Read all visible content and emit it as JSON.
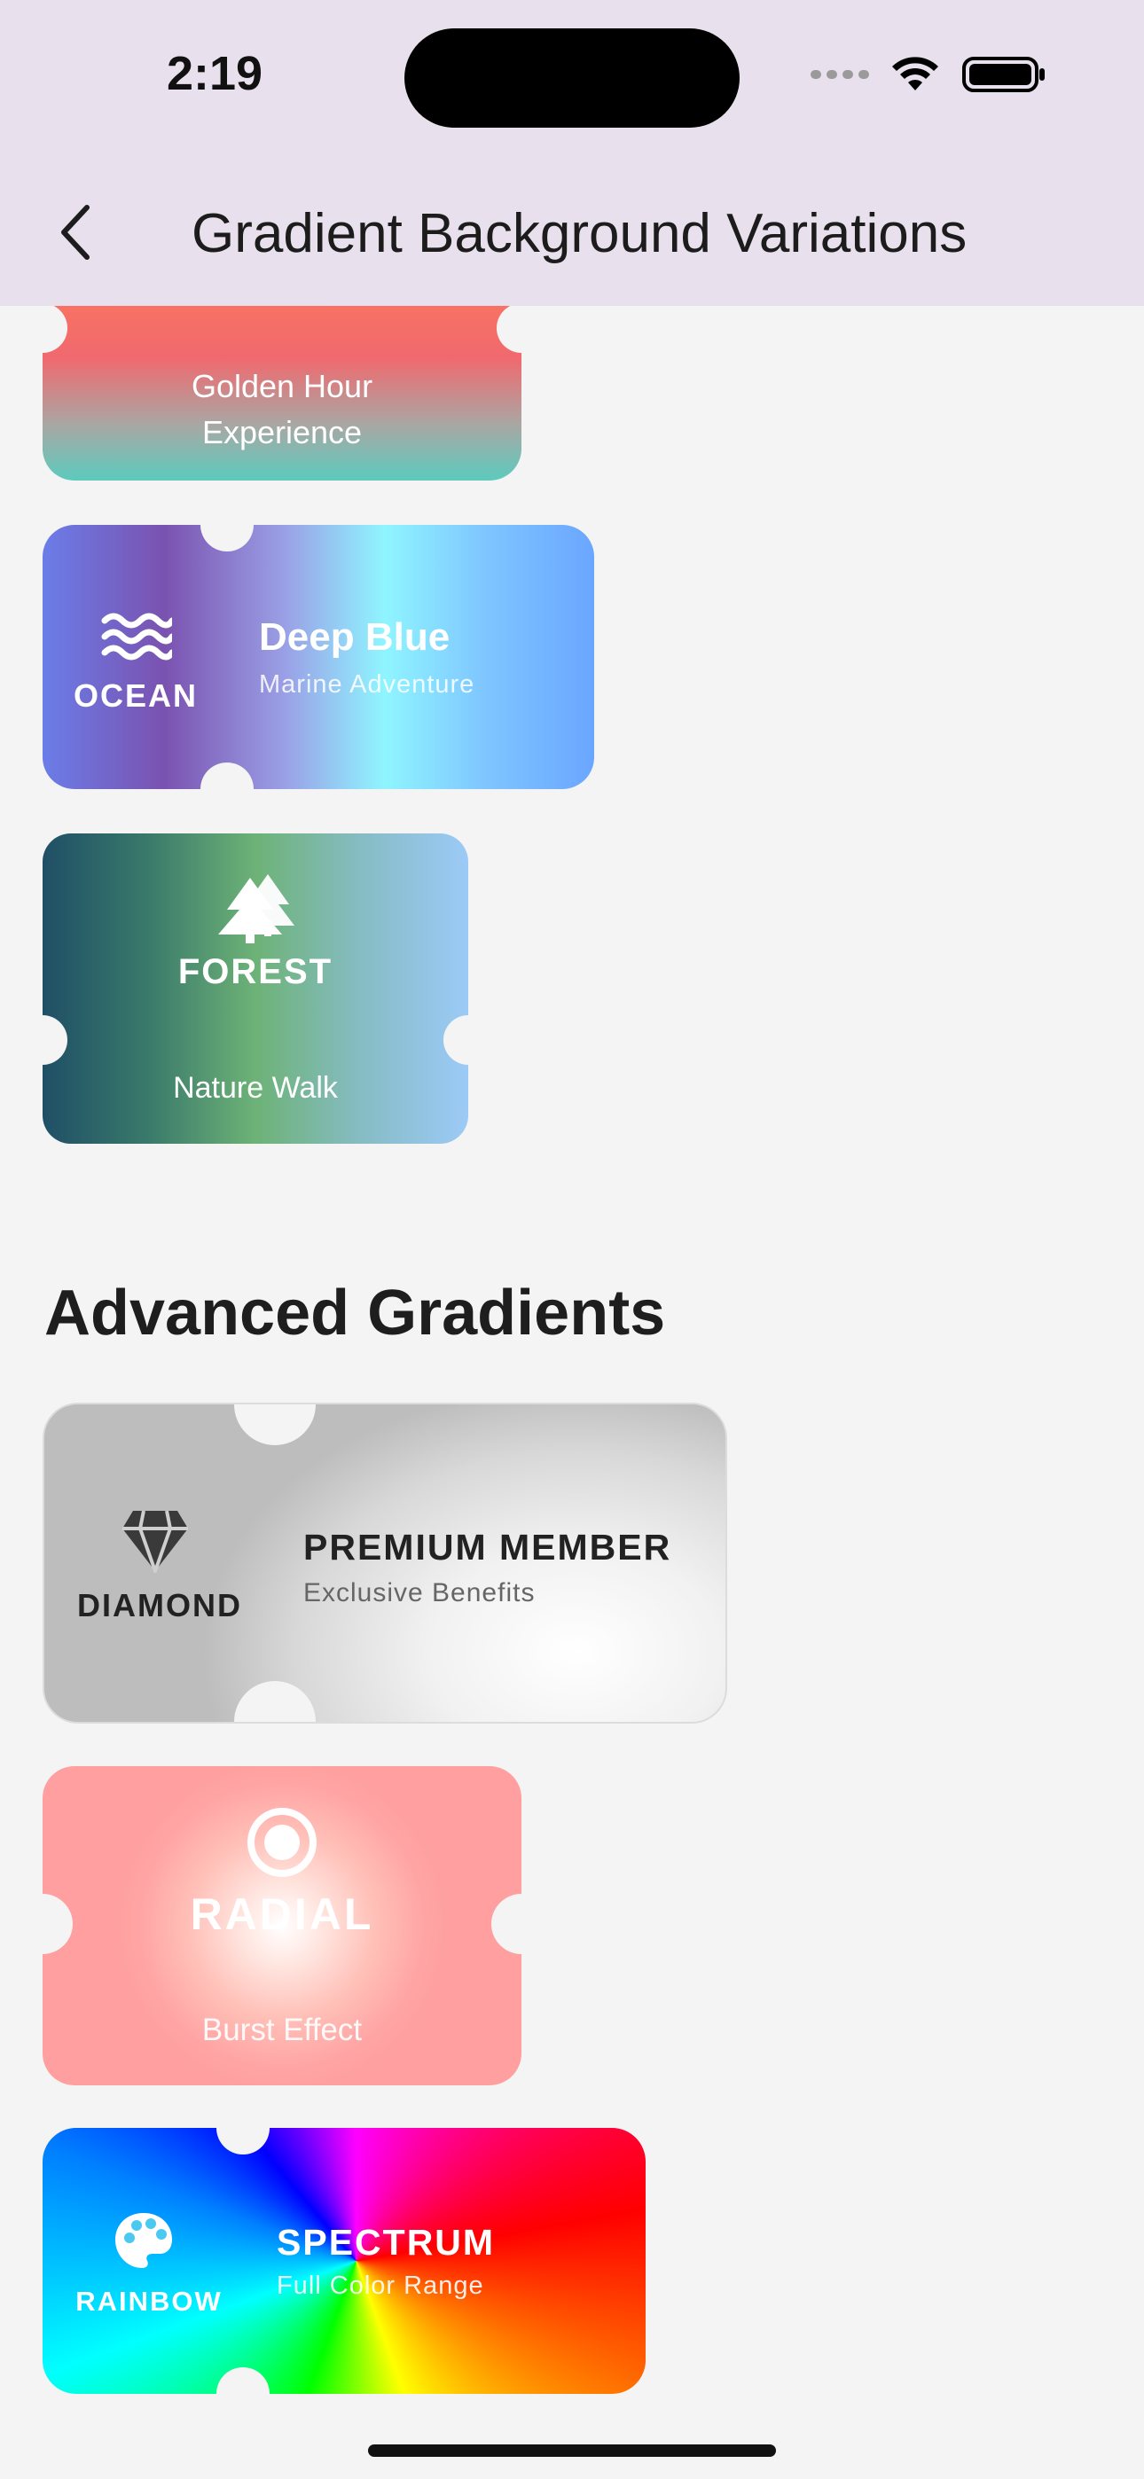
{
  "status_bar": {
    "time": "2:19"
  },
  "nav": {
    "title": "Gradient Background Variations"
  },
  "tickets": {
    "golden": {
      "line1": "Golden Hour",
      "line2": "Experience"
    },
    "ocean": {
      "badge": "OCEAN",
      "title": "Deep Blue",
      "subtitle": "Marine Adventure",
      "icon": "waves-icon"
    },
    "forest": {
      "title": "FOREST",
      "subtitle": "Nature Walk",
      "icon": "trees-icon"
    },
    "diamond": {
      "badge": "DIAMOND",
      "title": "PREMIUM MEMBER",
      "subtitle": "Exclusive Benefits",
      "icon": "diamond-icon"
    },
    "radial": {
      "title": "RADIAL",
      "subtitle": "Burst Effect",
      "icon": "target-icon"
    },
    "rainbow": {
      "badge": "RAINBOW",
      "title": "SPECTRUM",
      "subtitle": "Full Color Range",
      "icon": "palette-icon"
    }
  },
  "sections": {
    "advanced": "Advanced Gradients"
  },
  "colors": {
    "header_bg": "#e8e0ec",
    "page_bg": "#f4f4f4",
    "golden_top": "#ff7a5a",
    "golden_bottom": "#5ccbbd",
    "ocean_start": "#6b7de8",
    "ocean_mid": "#7a52b0",
    "ocean_cyan": "#8ff5ff",
    "ocean_end": "#6aa6ff",
    "forest_start": "#1f4f66",
    "forest_mid": "#6db277",
    "forest_end": "#9ccaf7",
    "radial_outer": "#ff9f9f"
  }
}
